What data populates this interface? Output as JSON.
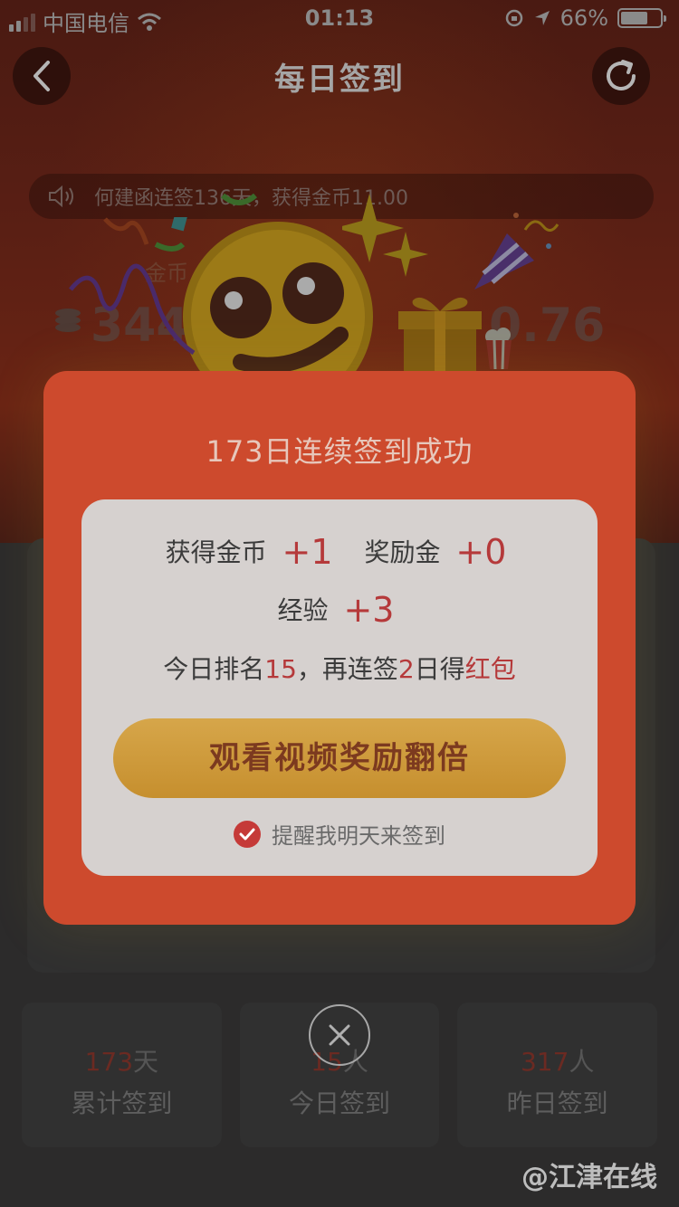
{
  "statusbar": {
    "carrier": "中国电信",
    "time": "01:13",
    "battery": "66%"
  },
  "nav": {
    "title": "每日签到"
  },
  "ticker": {
    "text": "何建函连签136天，获得金币11.00"
  },
  "background": {
    "coin_label": "金币",
    "coin_value": "344",
    "right_value": "0.76",
    "stats": [
      {
        "num": "173",
        "unit": "天",
        "label": "累计签到"
      },
      {
        "num": "15",
        "unit": "人",
        "label": "今日签到"
      },
      {
        "num": "317",
        "unit": "人",
        "label": "昨日签到"
      }
    ]
  },
  "modal": {
    "title": "173日连续签到成功",
    "coins_label": "获得金币",
    "coins_value": "+1",
    "bonus_label": "奖励金",
    "bonus_value": "+0",
    "exp_label": "经验",
    "exp_value": "+3",
    "rank_prefix": "今日排名",
    "rank_value": "15",
    "rank_mid": "，再连签",
    "days_value": "2",
    "rank_suffix1": "日得",
    "rank_suffix2": "红包",
    "cta_label": "观看视频奖励翻倍",
    "remind_label": "提醒我明天来签到"
  },
  "watermark": "@江津在线",
  "icons": [
    "back-icon",
    "refresh-icon",
    "speaker-icon",
    "check-icon",
    "close-icon",
    "emoji-icon",
    "gift-icon",
    "party-popper-icon",
    "sparkle-icon"
  ]
}
